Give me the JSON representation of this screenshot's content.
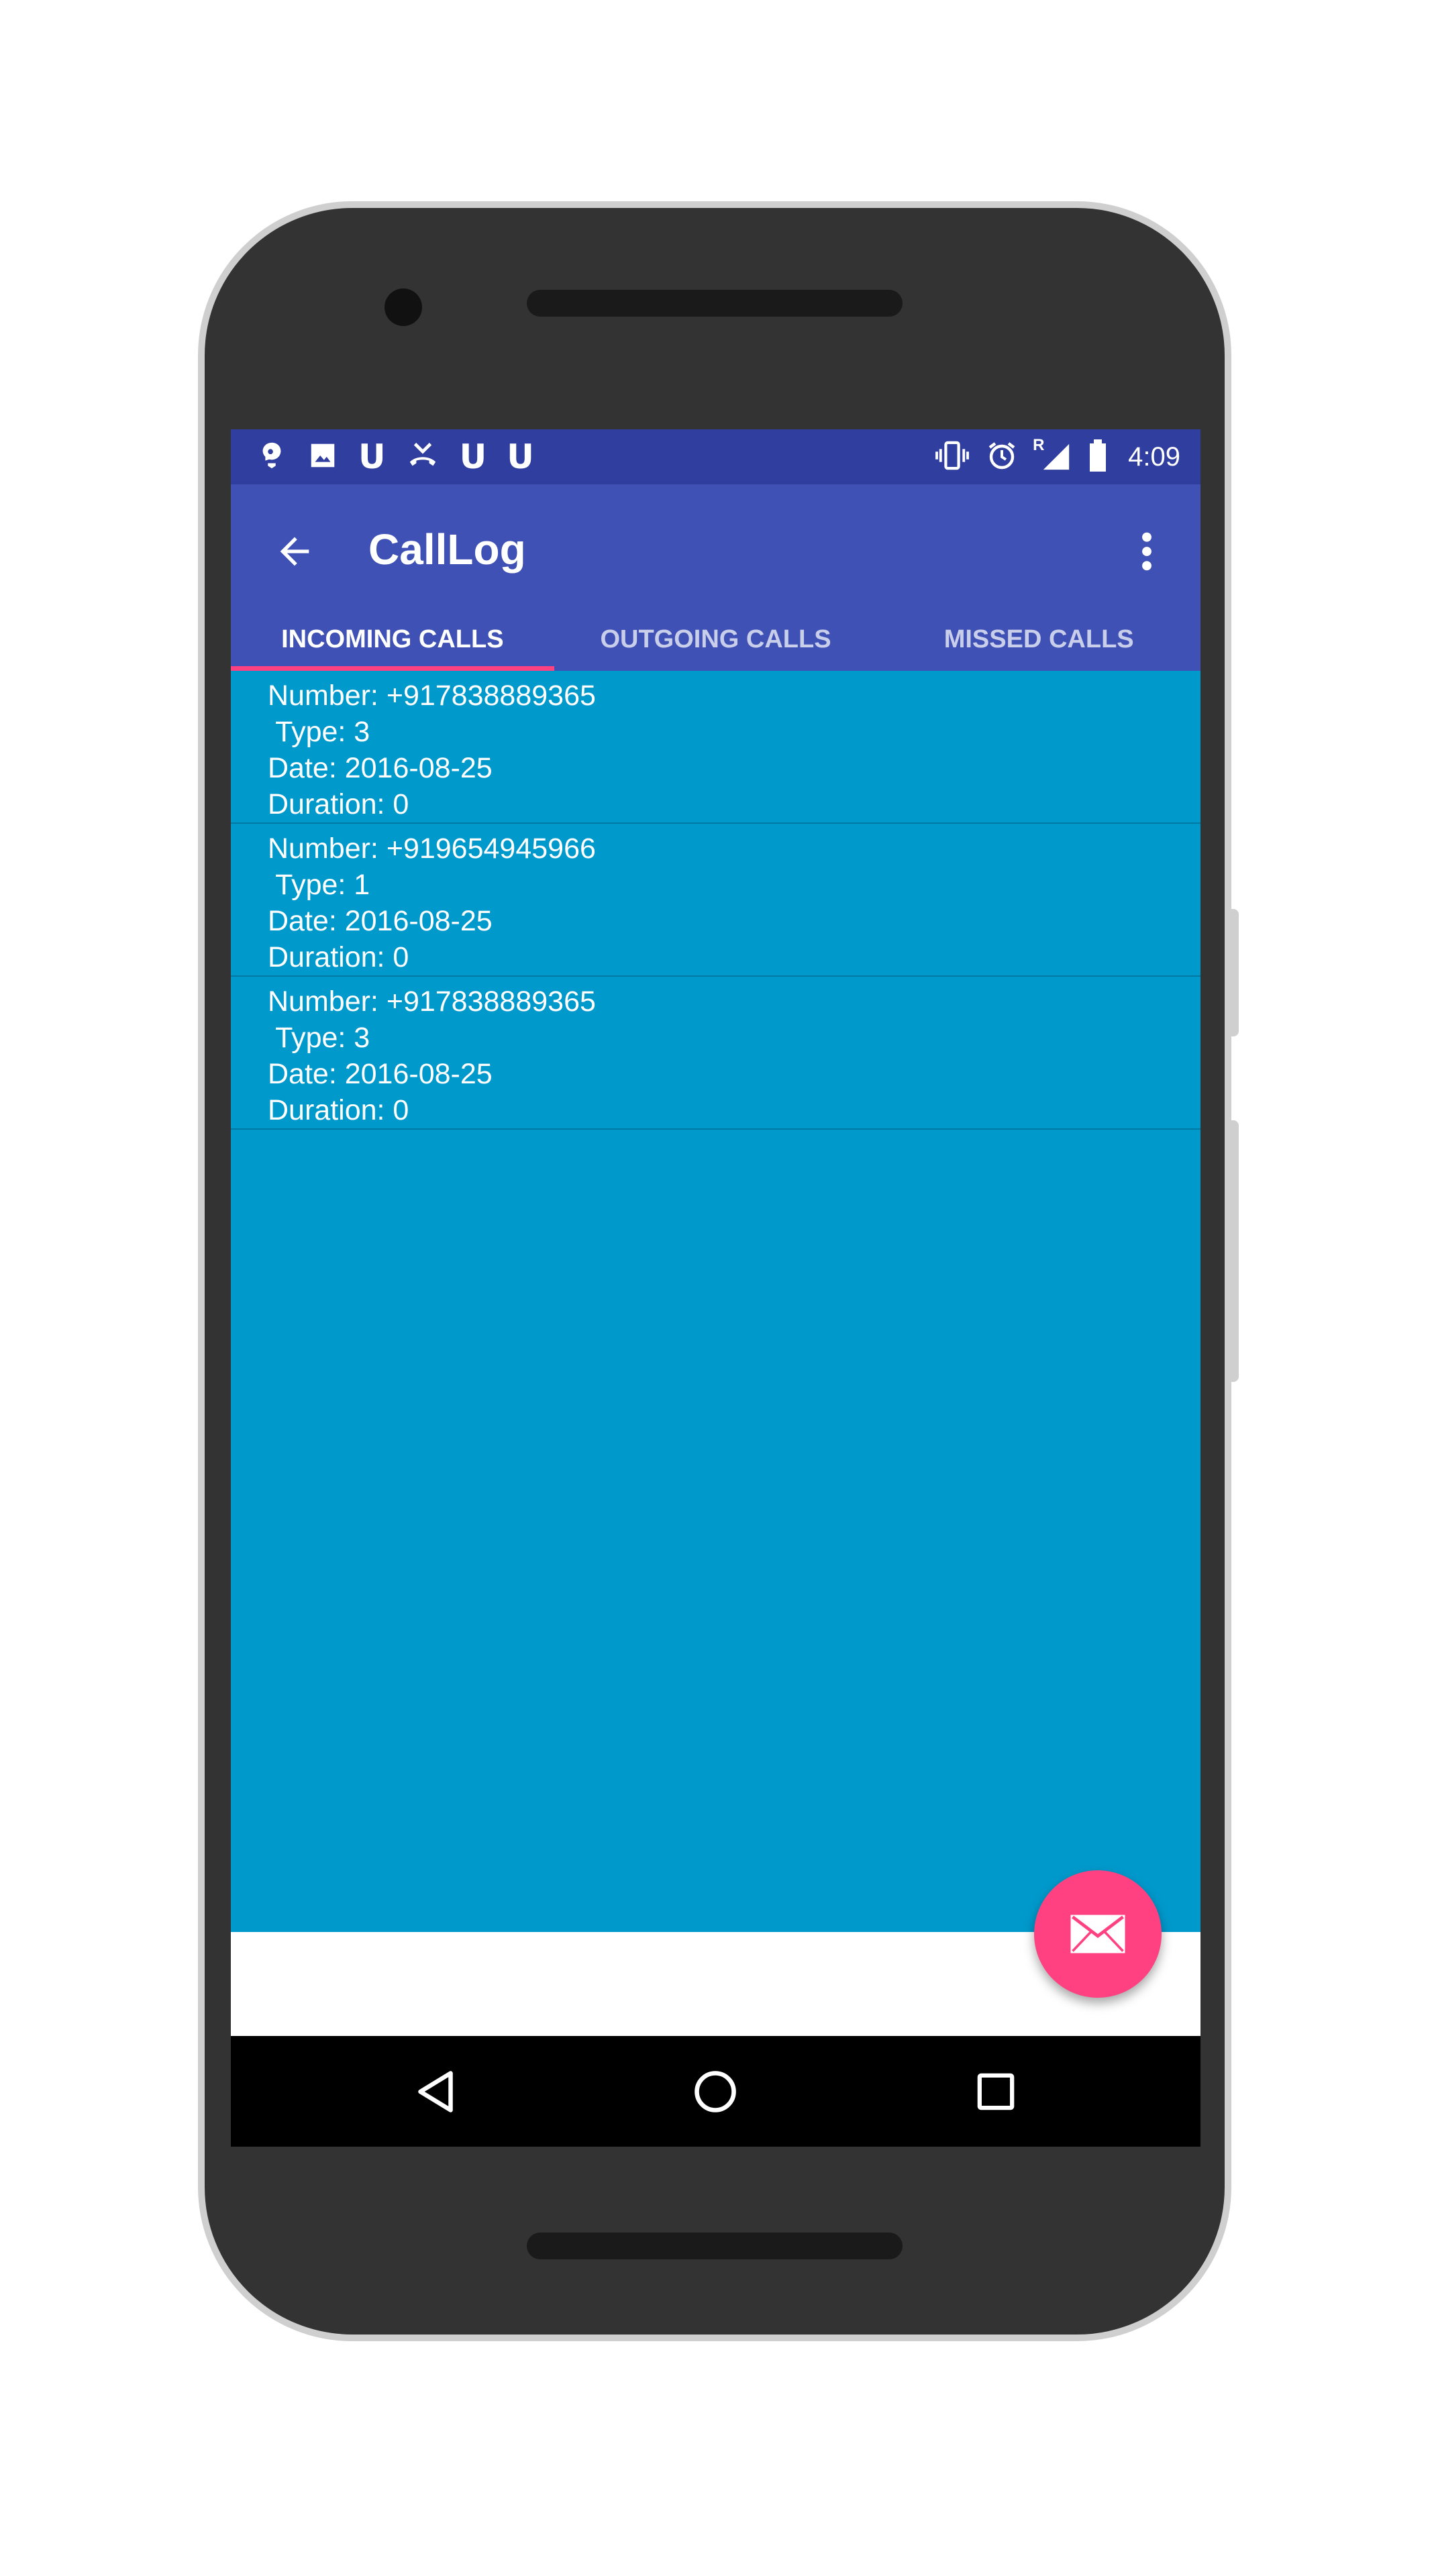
{
  "app": {
    "title": "CallLog"
  },
  "status_bar": {
    "time": "4:09",
    "left_icons": [
      "brain-notification-icon",
      "image-notification-icon",
      "u-notification-icon",
      "missed-call-icon",
      "u-notification-icon",
      "u-notification-icon"
    ],
    "right_icons": [
      "vibrate-icon",
      "alarm-icon",
      "signal-roaming-icon",
      "battery-icon"
    ],
    "roaming_label": "R"
  },
  "tabs": [
    {
      "label": "INCOMING CALLS",
      "active": true
    },
    {
      "label": "OUTGOING CALLS",
      "active": false
    },
    {
      "label": "MISSED CALLS",
      "active": false
    }
  ],
  "calls": [
    {
      "text": "Number: +917838889365\n Type: 3\nDate: 2016-08-25\nDuration: 0"
    },
    {
      "text": "Number: +919654945966\n Type: 1\nDate: 2016-08-25\nDuration: 0"
    },
    {
      "text": "Number: +917838889365\n Type: 3\nDate: 2016-08-25\nDuration: 0"
    }
  ],
  "colors": {
    "status_bar": "#303f9f",
    "app_bar": "#3f51b5",
    "accent": "#ff4081",
    "content_bg": "#0099cc"
  },
  "fab_icon": "mail-icon",
  "nav_icons": [
    "back-icon",
    "home-icon",
    "recents-icon"
  ]
}
